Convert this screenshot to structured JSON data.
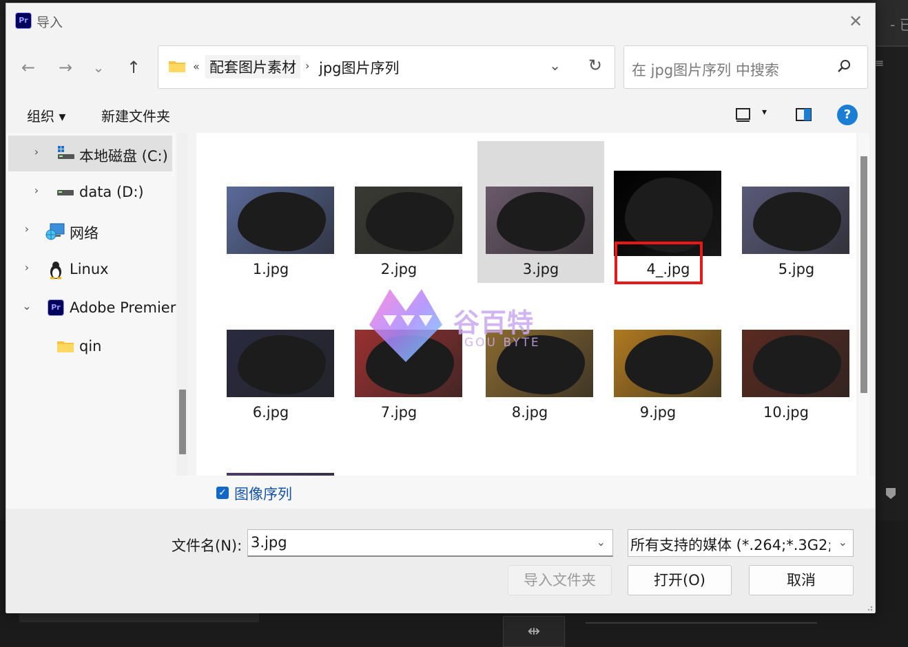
{
  "background_app": {
    "top_right_text": "- 已",
    "tool_glyph": "⇹"
  },
  "dialog": {
    "app_icon_text": "Pr",
    "title": "导入",
    "close_glyph": "✕"
  },
  "nav": {
    "back_glyph": "←",
    "forward_glyph": "→",
    "recent_glyph": "⌄",
    "up_glyph": "↑",
    "breadcrumb_overflow": "«",
    "breadcrumbs": [
      "配套图片素材",
      "jpg图片序列"
    ],
    "breadcrumb_sep": "›",
    "dropdown_glyph": "⌄",
    "refresh_glyph": "↻",
    "search_placeholder": "在 jpg图片序列 中搜索"
  },
  "toolbar": {
    "organize_label": "组织 ▾",
    "new_folder_label": "新建文件夹",
    "view_dd_glyph": "▾",
    "help_glyph": "?"
  },
  "navpane": {
    "items": [
      {
        "label": "本地磁盘 (C:)",
        "chevron": "›",
        "icon": "drive-windows-icon"
      },
      {
        "label": "data (D:)",
        "chevron": "›",
        "icon": "drive-icon"
      },
      {
        "label": "网络",
        "chevron": "›",
        "icon": "network-icon"
      },
      {
        "label": "Linux",
        "chevron": "›",
        "icon": "linux-icon"
      },
      {
        "label": "Adobe Premier",
        "chevron": "⌄",
        "icon": "premiere-icon"
      },
      {
        "label": "qin",
        "chevron": "",
        "icon": "folder-icon"
      }
    ]
  },
  "files": [
    {
      "name": "1.jpg",
      "tone": "#5a6a9a"
    },
    {
      "name": "2.jpg",
      "tone": "#3a3a34"
    },
    {
      "name": "3.jpg",
      "tone": "#6a5a6a"
    },
    {
      "name": "4_.jpg",
      "tone": "#000000"
    },
    {
      "name": "5.jpg",
      "tone": "#5a5a7a"
    },
    {
      "name": "6.jpg",
      "tone": "#2a2a40"
    },
    {
      "name": "7.jpg",
      "tone": "#9a3030"
    },
    {
      "name": "8.jpg",
      "tone": "#8a6a30"
    },
    {
      "name": "9.jpg",
      "tone": "#b07a20"
    },
    {
      "name": "10.jpg",
      "tone": "#5a2a20"
    }
  ],
  "partial_file_tone": "#4a3a6a",
  "image_sequence": {
    "label": "图像序列",
    "checked": true,
    "check_glyph": "✓"
  },
  "footer": {
    "filename_label": "文件名(N):",
    "filename_value": "3.jpg",
    "filename_dd_glyph": "⌄",
    "filter_value": "所有支持的媒体 (*.264;*.3G2;*.",
    "filter_dd_glyph": "⌄",
    "import_folder_label": "导入文件夹",
    "open_label": "打开(O)",
    "cancel_label": "取消"
  },
  "watermark": {
    "cn": "谷百特",
    "en": "GOU BYTE"
  },
  "colors": {
    "accent": "#1168c8",
    "highlight_box": "#e81818",
    "selected_tile": "#dcdcdc"
  }
}
